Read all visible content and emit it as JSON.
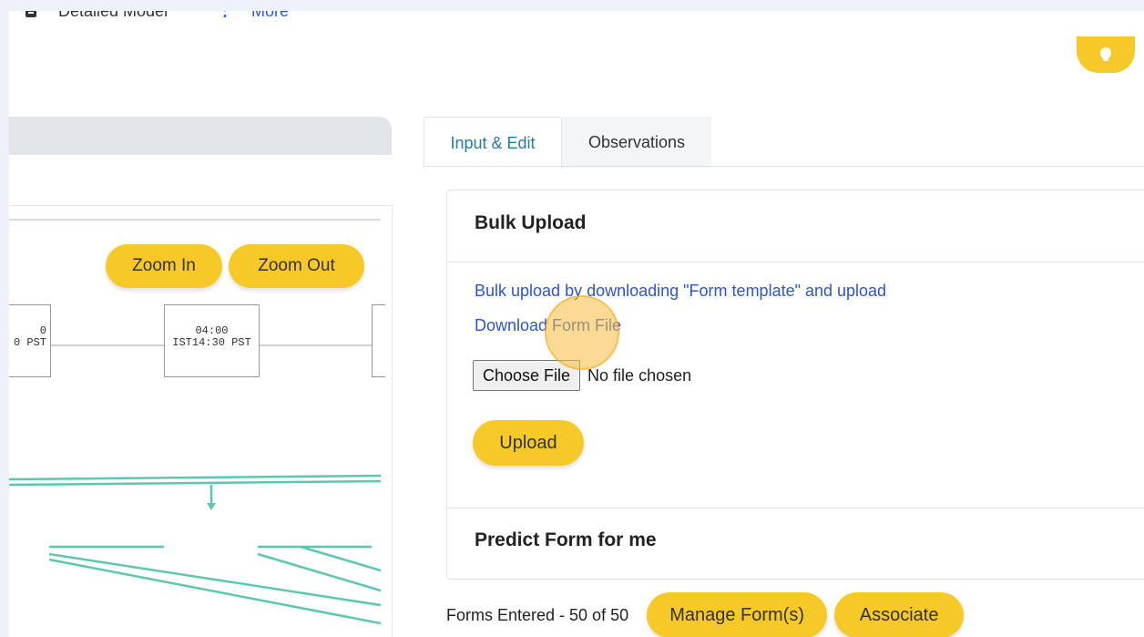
{
  "topnav": {
    "model_label": "Detailed Model",
    "more_label": "More"
  },
  "left": {
    "zoom_in_label": "Zoom In",
    "zoom_out_label": "Zoom Out",
    "nodes": [
      {
        "line1": "0",
        "line2": "0 PST"
      },
      {
        "line1": "04:00",
        "line2": "IST14:30 PST"
      }
    ]
  },
  "tabs": [
    {
      "label": "Input & Edit"
    },
    {
      "label": "Observations"
    }
  ],
  "bulk_upload": {
    "title": "Bulk Upload",
    "instruction_link": "Bulk upload by downloading \"Form template\" and upload",
    "download_link": "Download Form File",
    "choose_file_label": "Choose File",
    "file_status": "No file chosen",
    "upload_label": "Upload"
  },
  "predict": {
    "title": "Predict Form for me"
  },
  "footer": {
    "forms_count": "Forms Entered - 50 of 50",
    "manage_label": "Manage Form(s)",
    "associate_label": "Associate"
  },
  "colors": {
    "accent": "#f7c928",
    "link": "#2f55c8",
    "timeline": "#5cc7b0"
  },
  "icons": {
    "doc": "document-icon",
    "bulb": "lightbulb-icon",
    "kebab": "kebab-menu-icon"
  }
}
